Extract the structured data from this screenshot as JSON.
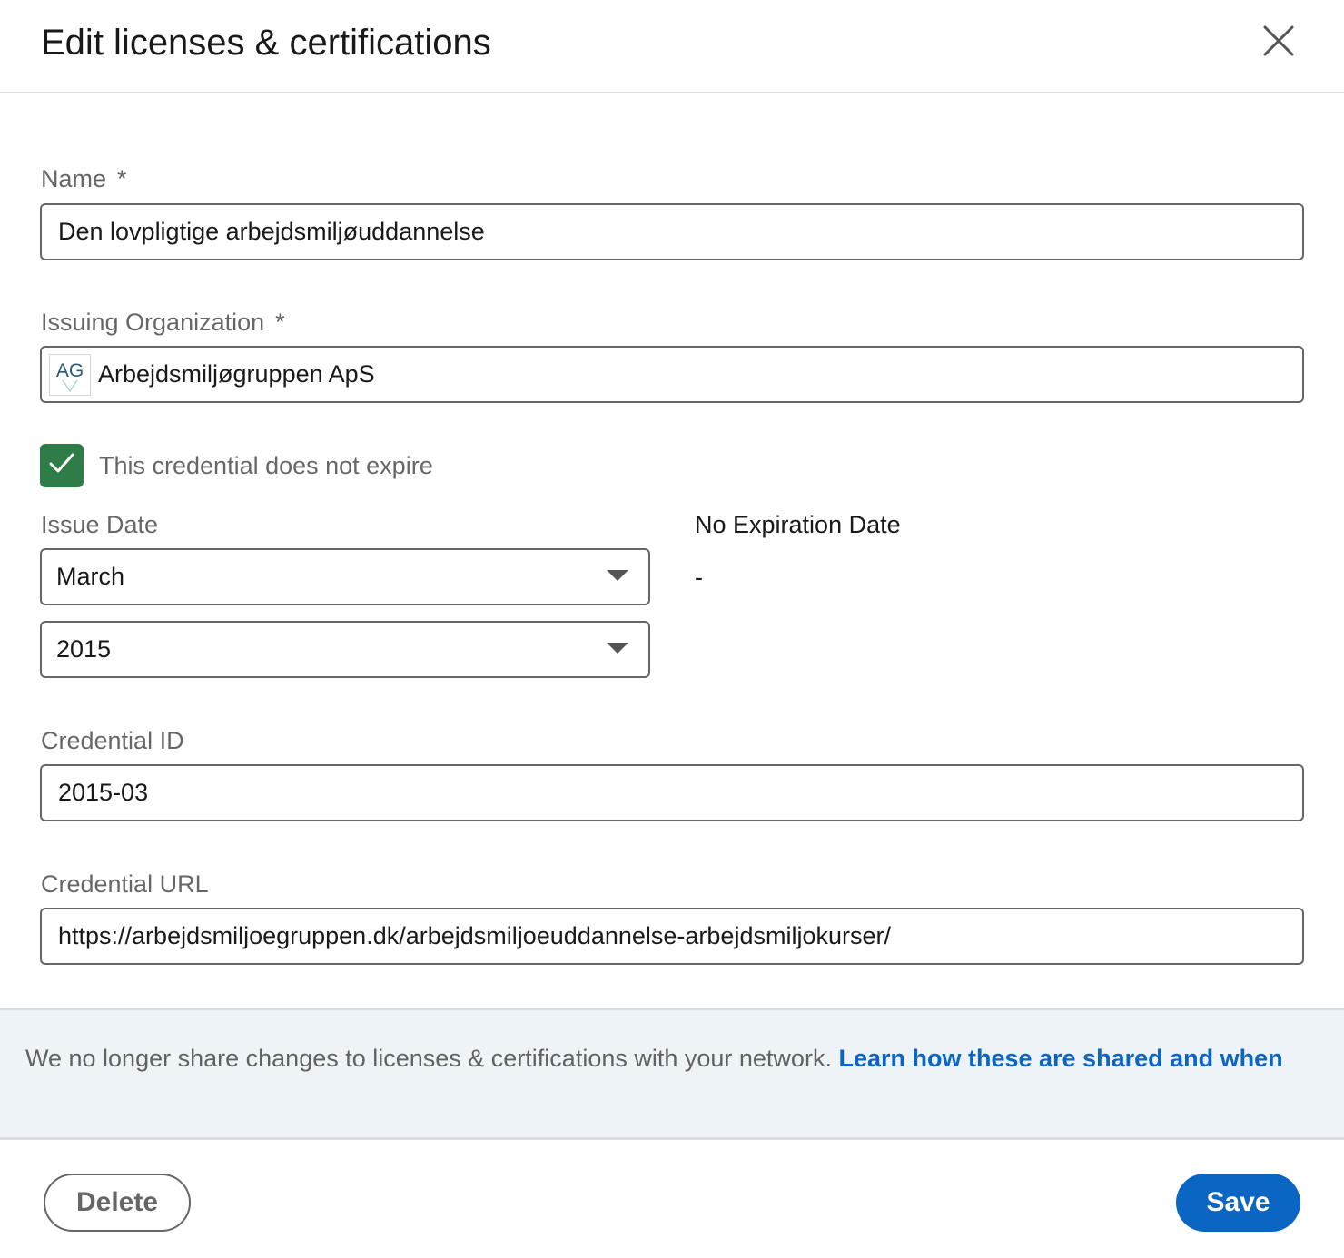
{
  "header": {
    "title": "Edit licenses & certifications",
    "close_icon": "close-icon"
  },
  "form": {
    "name": {
      "label": "Name",
      "required_mark": "*",
      "value": "Den lovpligtige arbejdsmiljøuddannelse"
    },
    "issuing_org": {
      "label": "Issuing Organization",
      "required_mark": "*",
      "logo_text": "AG",
      "value": "Arbejdsmiljøgruppen ApS"
    },
    "no_expire": {
      "label": "This credential does not expire",
      "checked": true,
      "check_icon": "checkmark-icon"
    },
    "issue_date": {
      "label": "Issue Date",
      "month": "March",
      "year": "2015",
      "caret_icon": "caret-down-icon"
    },
    "expiration": {
      "label": "No Expiration Date",
      "value": "-"
    },
    "credential_id": {
      "label": "Credential ID",
      "value": "2015-03"
    },
    "credential_url": {
      "label": "Credential URL",
      "value": "https://arbejdsmiljoegruppen.dk/arbejdsmiljoeuddannelse-arbejdsmiljokurser/"
    }
  },
  "notice": {
    "text": "We no longer share changes to licenses & certifications with your network.",
    "link_text": "Learn how these are shared and when"
  },
  "footer": {
    "delete_label": "Delete",
    "save_label": "Save"
  },
  "colors": {
    "primary": "#0a66c2",
    "checkbox": "#2e7d46",
    "notice_bg": "#eef3f8",
    "logo_text": "#2c5b7a"
  }
}
